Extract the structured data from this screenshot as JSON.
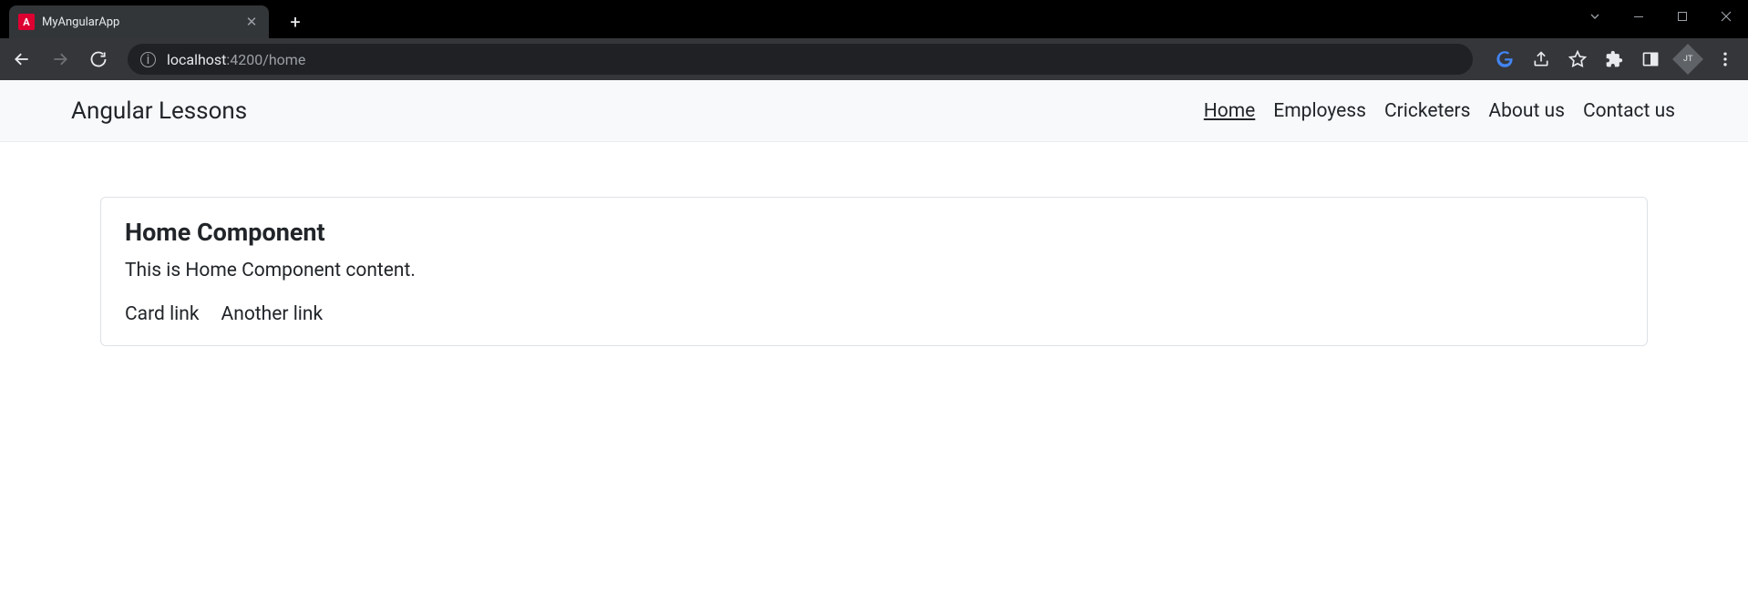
{
  "browser": {
    "tab_title": "MyAngularApp",
    "url_host": "localhost",
    "url_port_path": ":4200/home"
  },
  "navbar": {
    "brand": "Angular Lessons",
    "links": [
      {
        "label": "Home",
        "active": true
      },
      {
        "label": "Employess",
        "active": false
      },
      {
        "label": "Cricketers",
        "active": false
      },
      {
        "label": "About us",
        "active": false
      },
      {
        "label": "Contact us",
        "active": false
      }
    ]
  },
  "card": {
    "title": "Home Component",
    "text": "This is Home Component content.",
    "links": [
      {
        "label": "Card link"
      },
      {
        "label": "Another link"
      }
    ]
  }
}
